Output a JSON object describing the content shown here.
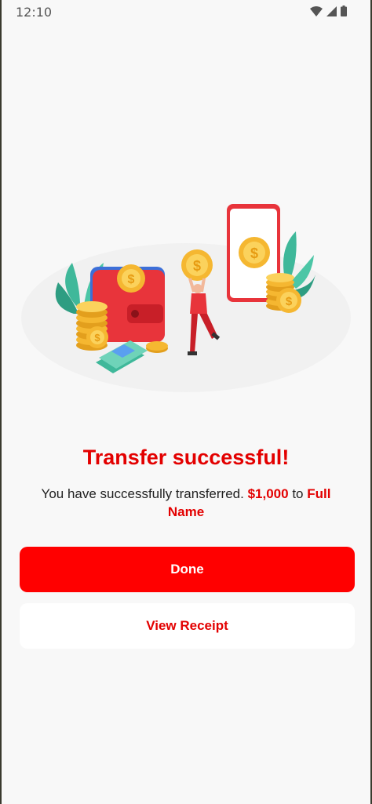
{
  "status_bar": {
    "time": "12:10"
  },
  "title": "Transfer successful!",
  "message": {
    "prefix": "You have successfully transferred.",
    "amount": "$1,000",
    "connector": "to",
    "recipient": "Full Name"
  },
  "buttons": {
    "done": "Done",
    "view_receipt": "View Receipt"
  },
  "colors": {
    "accent": "#ff0000",
    "background": "#f8f8f8",
    "gold": "#f5b731"
  },
  "icons": [
    "wifi-icon",
    "signal-icon",
    "battery-icon",
    "transfer-illustration"
  ]
}
